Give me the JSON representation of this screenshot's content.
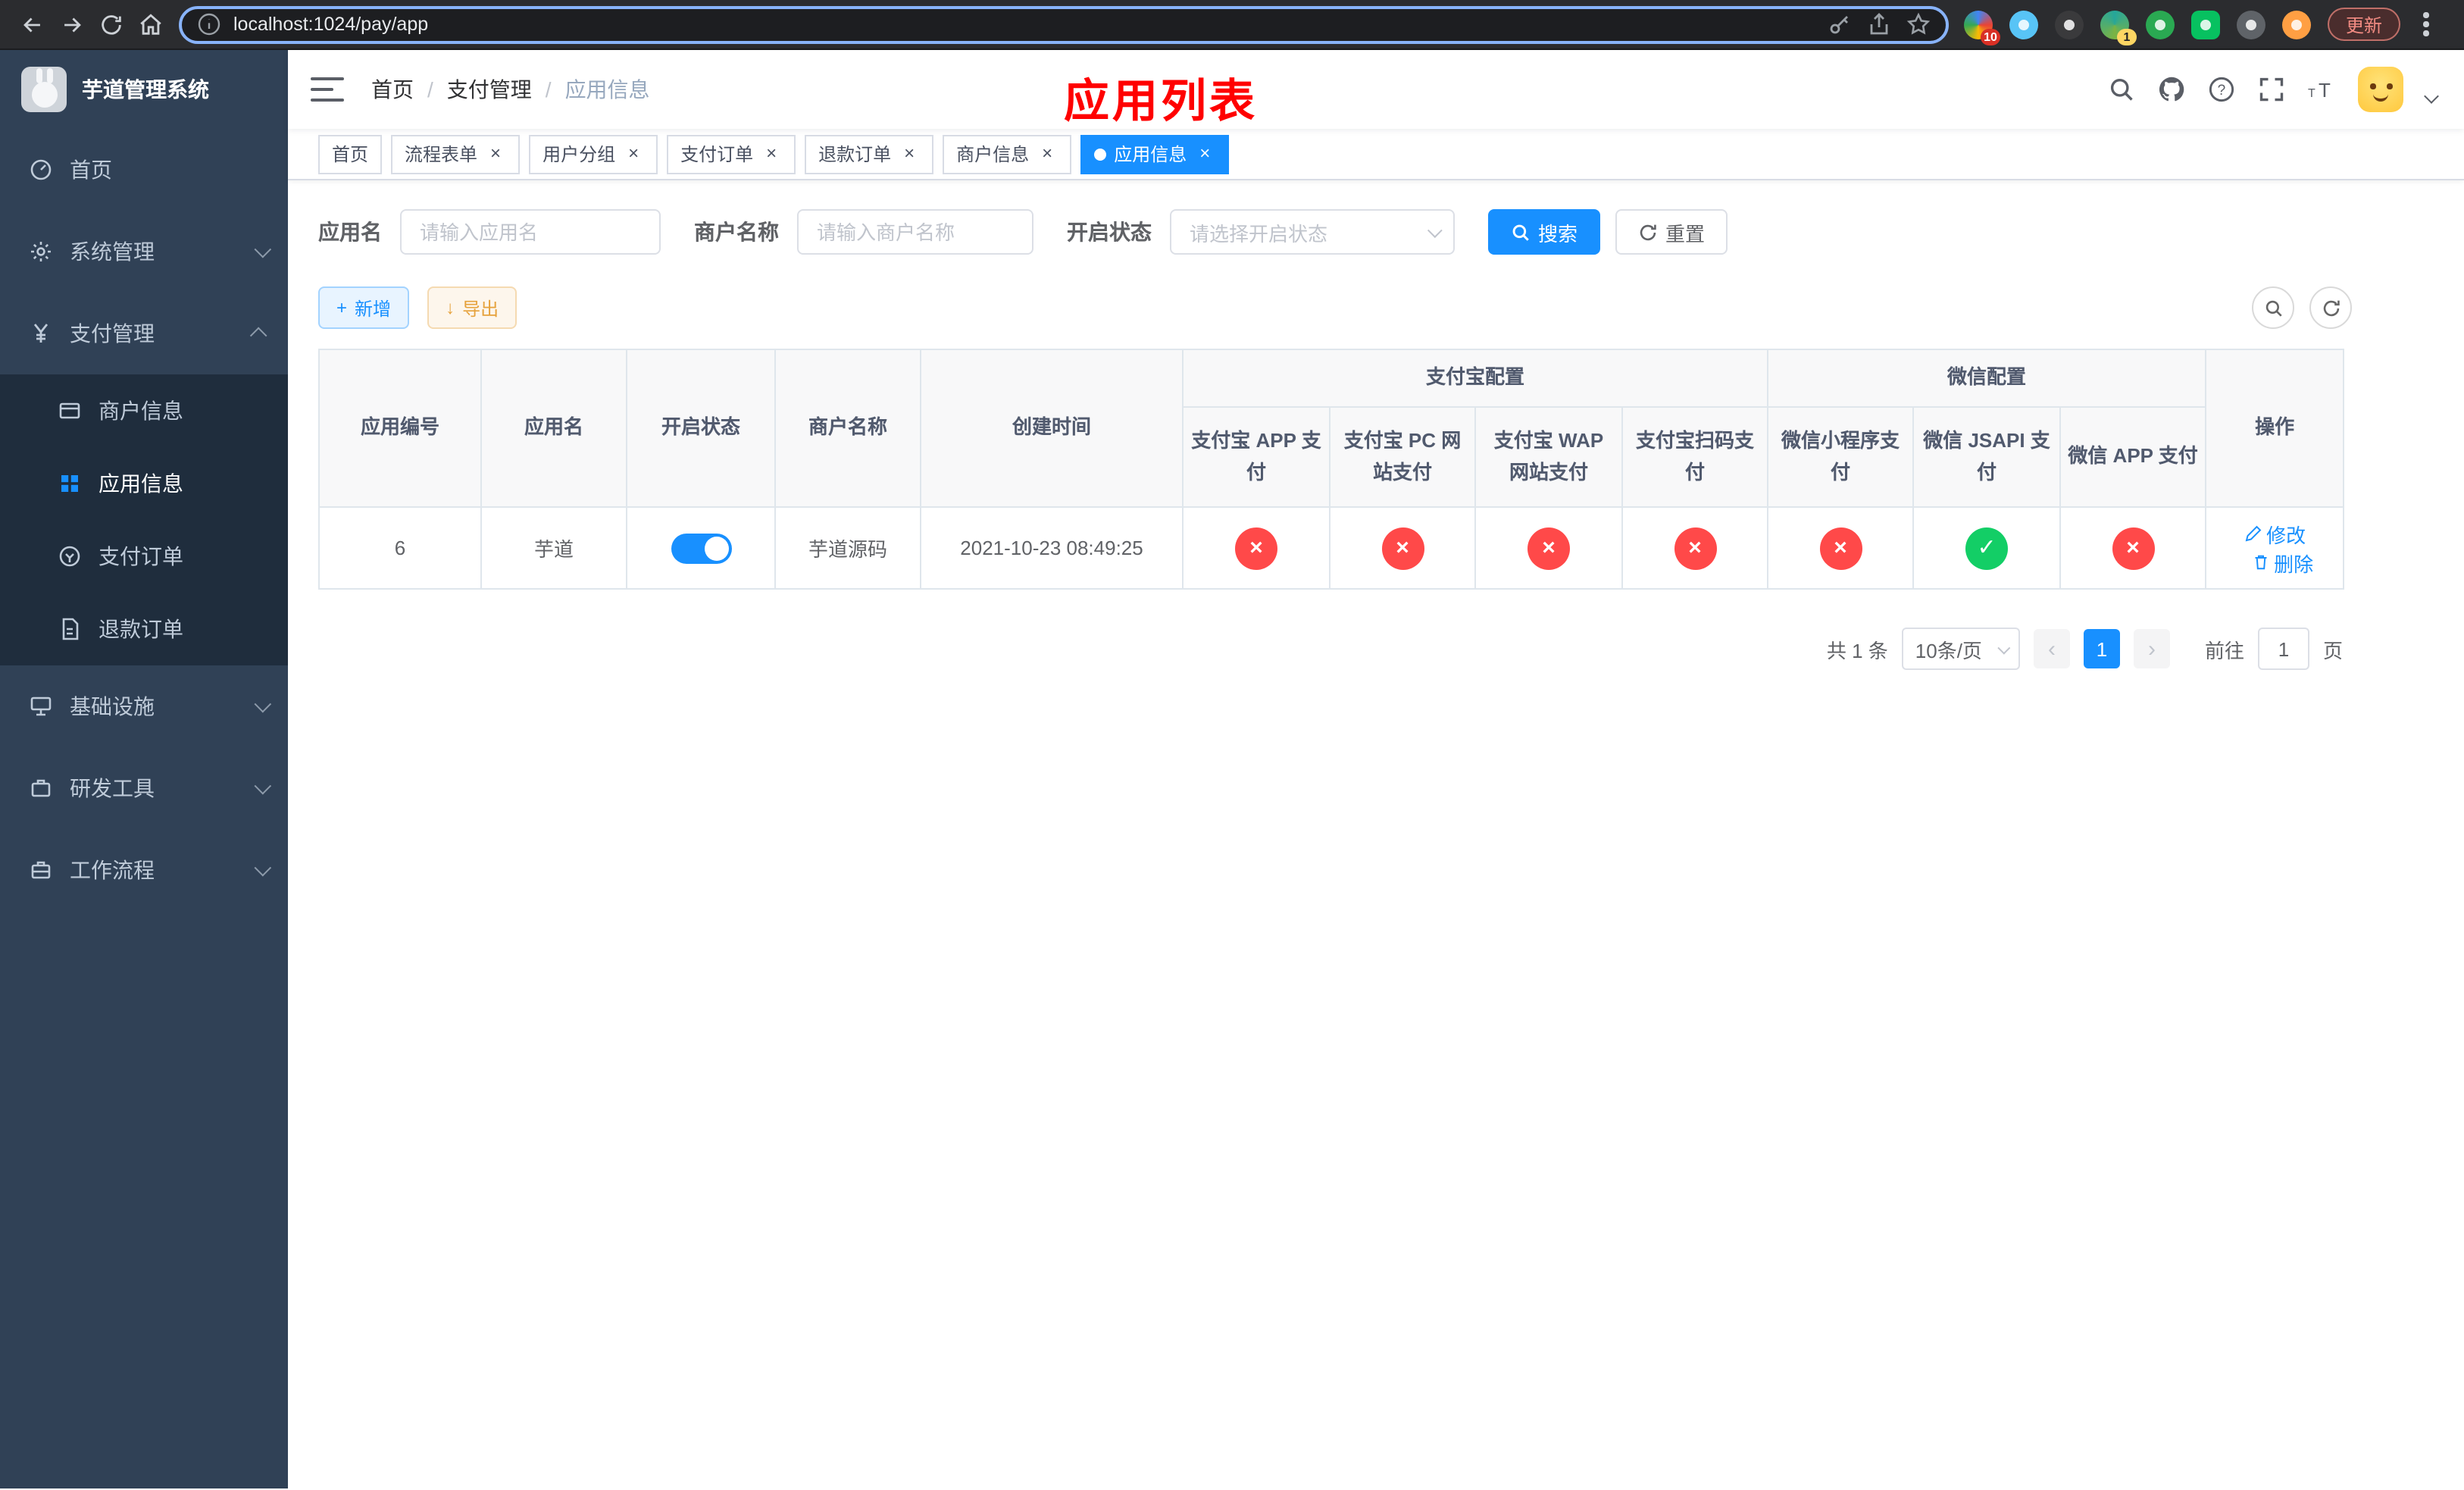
{
  "colors": {
    "accent": "#1890ff",
    "danger": "#ff4949",
    "success": "#13ce66"
  },
  "browser": {
    "url": "localhost:1024/pay/app",
    "update_label": "更新",
    "ext_badge_1": "10",
    "ext_badge_2": "1"
  },
  "sidebar": {
    "app_title": "芋道管理系统",
    "menu": [
      {
        "label": "首页"
      },
      {
        "label": "系统管理"
      },
      {
        "label": "支付管理"
      },
      {
        "label": "基础设施"
      },
      {
        "label": "研发工具"
      },
      {
        "label": "工作流程"
      }
    ],
    "submenu": [
      {
        "label": "商户信息"
      },
      {
        "label": "应用信息"
      },
      {
        "label": "支付订单"
      },
      {
        "label": "退款订单"
      }
    ]
  },
  "navbar": {
    "breadcrumb": [
      "首页",
      "支付管理",
      "应用信息"
    ],
    "page_title": "应用列表"
  },
  "tabs": [
    {
      "label": "首页"
    },
    {
      "label": "流程表单"
    },
    {
      "label": "用户分组"
    },
    {
      "label": "支付订单"
    },
    {
      "label": "退款订单"
    },
    {
      "label": "商户信息"
    },
    {
      "label": "应用信息"
    }
  ],
  "filters": {
    "app_name_label": "应用名",
    "app_name_placeholder": "请输入应用名",
    "merchant_label": "商户名称",
    "merchant_placeholder": "请输入商户名称",
    "status_label": "开启状态",
    "status_placeholder": "请选择开启状态",
    "search_label": "搜索",
    "reset_label": "重置"
  },
  "toolbar": {
    "add_label": "新增",
    "export_label": "导出"
  },
  "table": {
    "group_alipay": "支付宝配置",
    "group_wechat": "微信配置",
    "col_app_id": "应用编号",
    "col_app_name": "应用名",
    "col_status": "开启状态",
    "col_merchant": "商户名称",
    "col_created": "创建时间",
    "col_alipay_app": "支付宝 APP 支付",
    "col_alipay_pc": "支付宝 PC 网站支付",
    "col_alipay_wap": "支付宝 WAP 网站支付",
    "col_alipay_scan": "支付宝扫码支付",
    "col_wx_mini": "微信小程序支付",
    "col_wx_jsapi": "微信 JSAPI 支付",
    "col_wx_app": "微信 APP 支付",
    "col_actions": "操作",
    "icons": {
      "off": "×",
      "on": "✓"
    },
    "row": {
      "app_id": "6",
      "app_name": "芋道",
      "merchant": "芋道源码",
      "created": "2021-10-23 08:49:25",
      "edit_label": "修改",
      "delete_label": "删除"
    }
  },
  "pagination": {
    "total": "共 1 条",
    "page_size": "10条/页",
    "current_page": "1",
    "goto_prefix": "前往",
    "goto_value": "1",
    "goto_suffix": "页"
  }
}
